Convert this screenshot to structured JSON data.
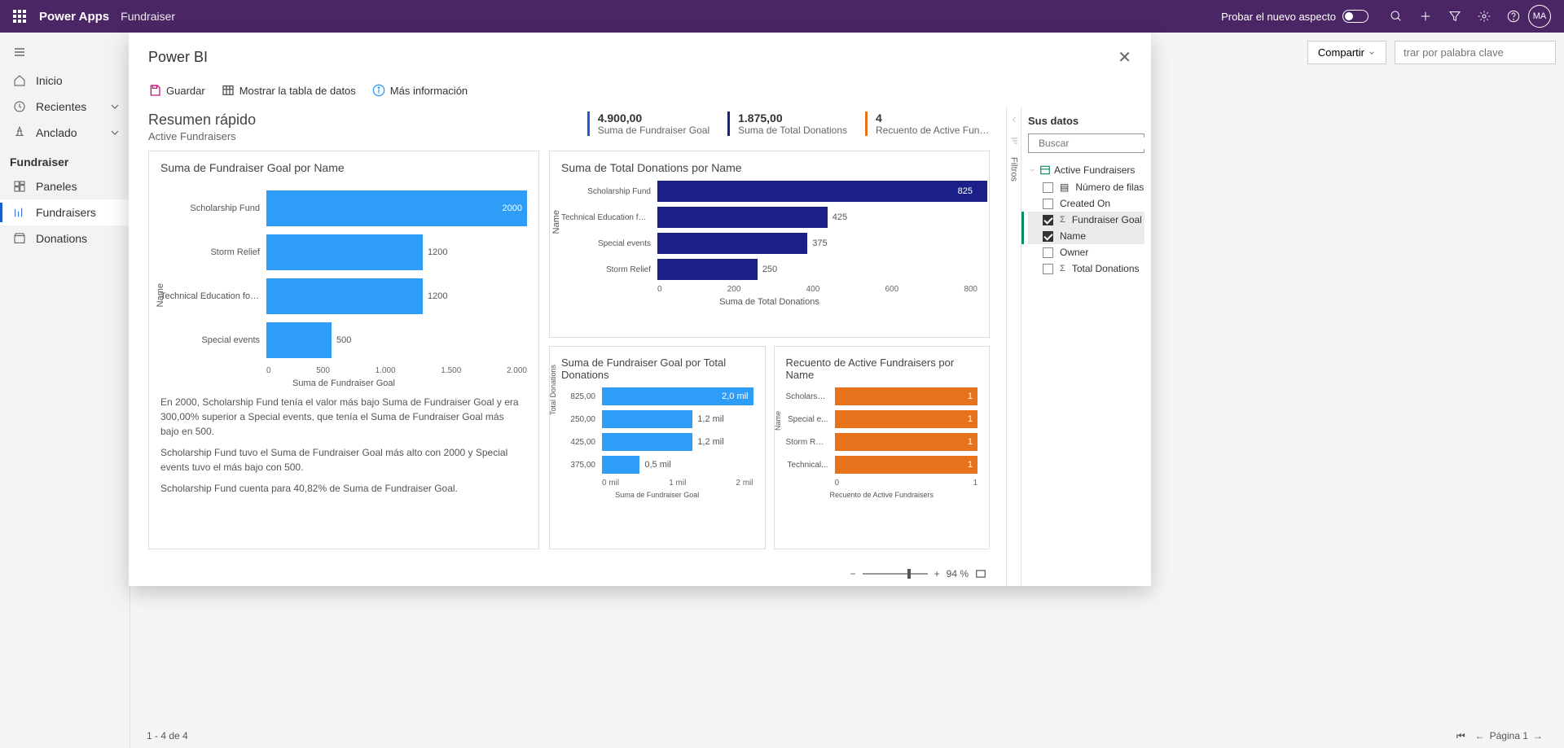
{
  "header": {
    "brand": "Power Apps",
    "app": "Fundraiser",
    "try_label": "Probar el nuevo aspecto",
    "avatar": "MA"
  },
  "nav": {
    "inicio": "Inicio",
    "recientes": "Recientes",
    "anclado": "Anclado",
    "section": "Fundraiser",
    "paneles": "Paneles",
    "fundraisers": "Fundraisers",
    "donations": "Donations"
  },
  "cmd": {
    "compartir": "Compartir",
    "filter_placeholder": "trar por palabra clave"
  },
  "footer": {
    "range": "1 - 4 de 4",
    "page": "Página 1"
  },
  "modal": {
    "title": "Power BI",
    "guardar": "Guardar",
    "mostrar": "Mostrar la tabla de datos",
    "mas_info": "Más información",
    "zoom_pct": "94 %"
  },
  "report": {
    "title": "Resumen rápido",
    "subtitle": "Active Fundraisers",
    "kpis": [
      {
        "value": "4.900,00",
        "label": "Suma de Fundraiser Goal",
        "color": "#1a5fc9"
      },
      {
        "value": "1.875,00",
        "label": "Suma de Total Donations",
        "color": "#1b1f88"
      },
      {
        "value": "4",
        "label": "Recuento de Active Fund...",
        "color": "#e8711c"
      }
    ],
    "insight1": "En 2000, Scholarship Fund tenía el valor más bajo Suma de Fundraiser Goal y era 300,00% superior a Special events, que tenía el Suma de Fundraiser Goal más bajo en 500.",
    "insight2": "Scholarship Fund tuvo el Suma de Fundraiser Goal más alto con 2000 y Special events tuvo el más bajo con 500.",
    "insight3": "Scholarship Fund cuenta para 40,82% de Suma de Fundraiser Goal."
  },
  "datapanel": {
    "title": "Sus datos",
    "search_ph": "Buscar",
    "table": "Active Fundraisers",
    "fields": {
      "numero_filas": "Número de filas",
      "created_on": "Created On",
      "fundraiser_goal": "Fundraiser Goal",
      "name": "Name",
      "owner": "Owner",
      "total_donations": "Total Donations"
    }
  },
  "filtros_label": "Filtros",
  "chart_data": [
    {
      "id": "goal_by_name",
      "type": "bar",
      "orientation": "horizontal",
      "title": "Suma de Fundraiser Goal por Name",
      "ylabel": "Name",
      "xlabel": "Suma de Fundraiser Goal",
      "xlim": [
        0,
        2000
      ],
      "ticks": [
        "0",
        "500",
        "1.000",
        "1.500",
        "2.000"
      ],
      "color": "#2e9df7",
      "categories": [
        "Scholarship Fund",
        "Storm Relief",
        "Technical Education for ...",
        "Special events"
      ],
      "values": [
        2000,
        1200,
        1200,
        500
      ],
      "value_labels": [
        "2000",
        "1200",
        "1200",
        "500"
      ]
    },
    {
      "id": "donations_by_name",
      "type": "bar",
      "orientation": "horizontal",
      "title": "Suma de Total Donations por Name",
      "ylabel": "Name",
      "xlabel": "Suma de Total Donations",
      "xlim": [
        0,
        800
      ],
      "ticks": [
        "0",
        "200",
        "400",
        "600",
        "800"
      ],
      "color": "#1b1f88",
      "categories": [
        "Scholarship Fund",
        "Technical Education for ...",
        "Special events",
        "Storm Relief"
      ],
      "values": [
        825,
        425,
        375,
        250
      ],
      "value_labels": [
        "825",
        "425",
        "375",
        "250"
      ]
    },
    {
      "id": "goal_by_donations",
      "type": "bar",
      "orientation": "horizontal",
      "title": "Suma de Fundraiser Goal por Total Donations",
      "ylabel": "Total Donations",
      "xlabel": "Suma de Fundraiser Goal",
      "xlim": [
        0,
        2000
      ],
      "ticks": [
        "0 mil",
        "1 mil",
        "2 mil"
      ],
      "color": "#2e9df7",
      "categories": [
        "825,00",
        "250,00",
        "425,00",
        "375,00"
      ],
      "values": [
        2000,
        1200,
        1200,
        500
      ],
      "value_labels": [
        "2,0 mil",
        "1,2 mil",
        "1,2 mil",
        "0,5 mil"
      ]
    },
    {
      "id": "count_by_name",
      "type": "bar",
      "orientation": "horizontal",
      "title": "Recuento de Active Fundraisers por Name",
      "ylabel": "Name",
      "xlabel": "Recuento de Active Fundraisers",
      "xlim": [
        0,
        1
      ],
      "ticks": [
        "0",
        "1"
      ],
      "color": "#e8711c",
      "categories": [
        "Scholarsh...",
        "Special e...",
        "Storm Rel...",
        "Technical..."
      ],
      "values": [
        1,
        1,
        1,
        1
      ],
      "value_labels": [
        "1",
        "1",
        "1",
        "1"
      ]
    }
  ]
}
